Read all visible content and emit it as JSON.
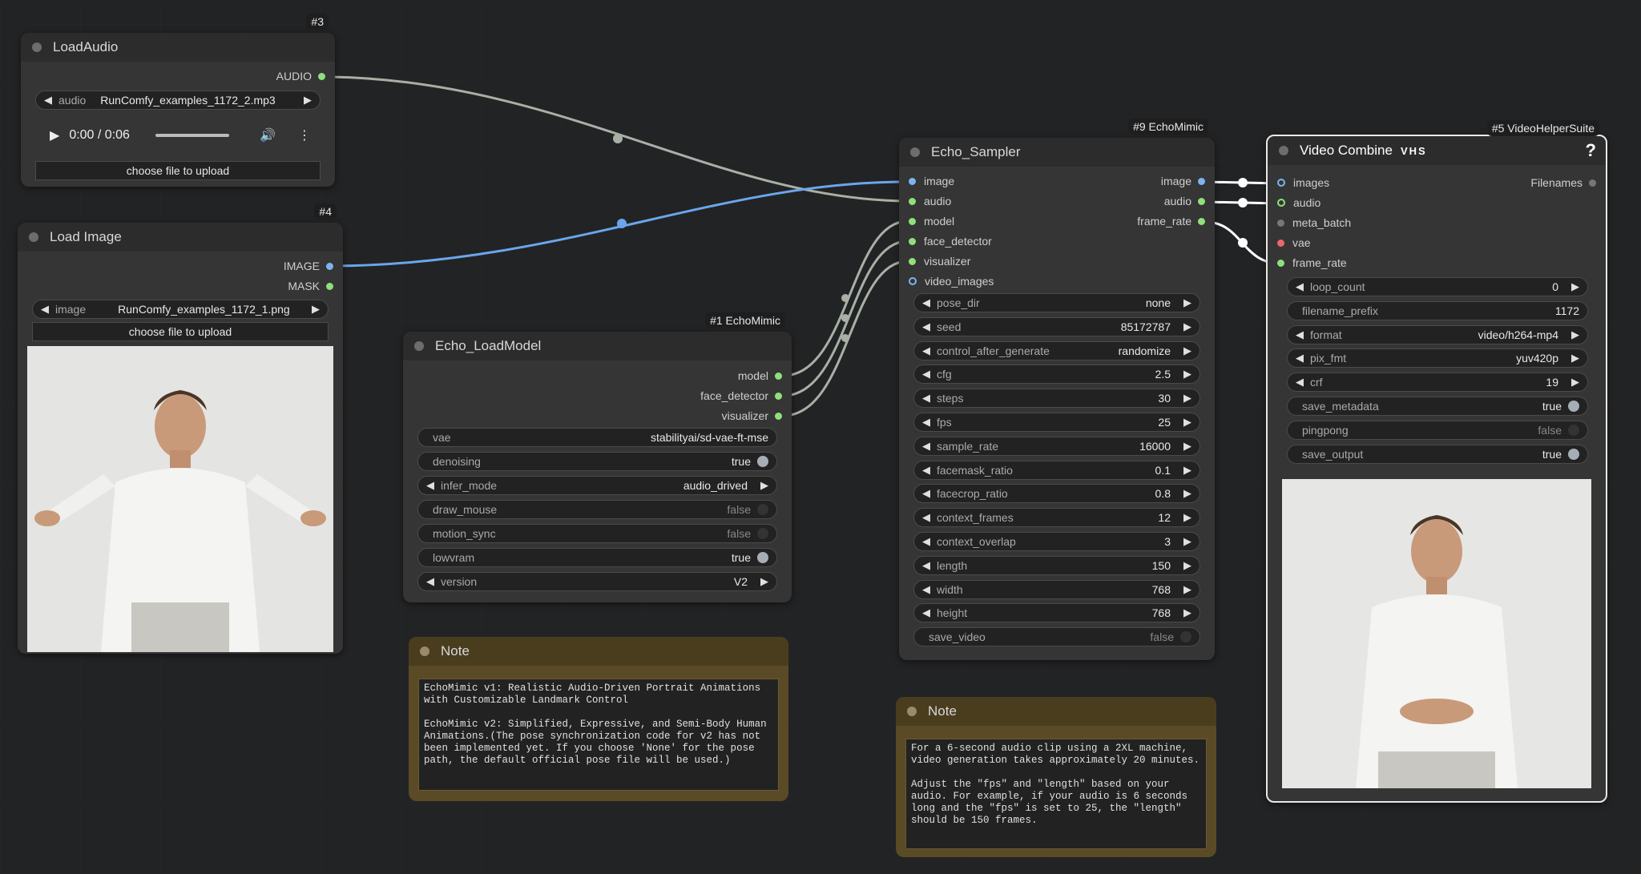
{
  "colors": {
    "canvas": "#222324",
    "node": "#353535",
    "link_audio": "#a8b0a6",
    "link_image": "#6aa6ec",
    "note": "#5a4a25"
  },
  "load_audio": {
    "badge": "#3",
    "title": "LoadAudio",
    "out_audio": "AUDIO",
    "widget_label": "audio",
    "widget_value": "RunComfy_examples_1172_2.mp3",
    "player_time": "0:00 / 0:06",
    "upload_label": "choose file to upload"
  },
  "load_image": {
    "badge": "#4",
    "title": "Load Image",
    "out_image": "IMAGE",
    "out_mask": "MASK",
    "widget_label": "image",
    "widget_value": "RunComfy_examples_1172_1.png",
    "upload_label": "choose file to upload"
  },
  "load_model": {
    "badge": "#1 EchoMimic",
    "title": "Echo_LoadModel",
    "outputs": [
      "model",
      "face_detector",
      "visualizer"
    ],
    "widgets": [
      {
        "label": "vae",
        "value": "stabilityai/sd-vae-ft-mse",
        "kind": "text"
      },
      {
        "label": "denoising",
        "value": "true",
        "kind": "toggle-on"
      },
      {
        "label": "infer_mode",
        "value": "audio_drived",
        "kind": "combo"
      },
      {
        "label": "draw_mouse",
        "value": "false",
        "kind": "toggle-off"
      },
      {
        "label": "motion_sync",
        "value": "false",
        "kind": "toggle-off"
      },
      {
        "label": "lowvram",
        "value": "true",
        "kind": "toggle-on"
      },
      {
        "label": "version",
        "value": "V2",
        "kind": "combo"
      }
    ]
  },
  "sampler": {
    "badge": "#9 EchoMimic",
    "title": "Echo_Sampler",
    "inputs": [
      "image",
      "audio",
      "model",
      "face_detector",
      "visualizer",
      "video_images"
    ],
    "outputs": [
      "image",
      "audio",
      "frame_rate"
    ],
    "widgets": [
      {
        "label": "pose_dir",
        "value": "none",
        "kind": "combo"
      },
      {
        "label": "seed",
        "value": "85172787",
        "kind": "combo"
      },
      {
        "label": "control_after_generate",
        "value": "randomize",
        "kind": "combo"
      },
      {
        "label": "cfg",
        "value": "2.5",
        "kind": "combo"
      },
      {
        "label": "steps",
        "value": "30",
        "kind": "combo"
      },
      {
        "label": "fps",
        "value": "25",
        "kind": "combo"
      },
      {
        "label": "sample_rate",
        "value": "16000",
        "kind": "combo"
      },
      {
        "label": "facemask_ratio",
        "value": "0.1",
        "kind": "combo"
      },
      {
        "label": "facecrop_ratio",
        "value": "0.8",
        "kind": "combo"
      },
      {
        "label": "context_frames",
        "value": "12",
        "kind": "combo"
      },
      {
        "label": "context_overlap",
        "value": "3",
        "kind": "combo"
      },
      {
        "label": "length",
        "value": "150",
        "kind": "combo"
      },
      {
        "label": "width",
        "value": "768",
        "kind": "combo"
      },
      {
        "label": "height",
        "value": "768",
        "kind": "combo"
      },
      {
        "label": "save_video",
        "value": "false",
        "kind": "toggle-off"
      }
    ]
  },
  "video_combine": {
    "badge": "#5 VideoHelperSuite",
    "title": "Video Combine",
    "title_tag": "VHS",
    "help": "?",
    "inputs": [
      "images",
      "audio",
      "meta_batch",
      "vae",
      "frame_rate"
    ],
    "output": "Filenames",
    "widgets": [
      {
        "label": "loop_count",
        "value": "0",
        "kind": "combo"
      },
      {
        "label": "filename_prefix",
        "value": "1172",
        "kind": "text"
      },
      {
        "label": "format",
        "value": "video/h264-mp4",
        "kind": "combo"
      },
      {
        "label": "pix_fmt",
        "value": "yuv420p",
        "kind": "combo"
      },
      {
        "label": "crf",
        "value": "19",
        "kind": "combo"
      },
      {
        "label": "save_metadata",
        "value": "true",
        "kind": "toggle-on"
      },
      {
        "label": "pingpong",
        "value": "false",
        "kind": "toggle-off"
      },
      {
        "label": "save_output",
        "value": "true",
        "kind": "toggle-on"
      }
    ]
  },
  "note1": {
    "title": "Note",
    "text": "EchoMimic v1: Realistic Audio-Driven Portrait Animations\nwith Customizable Landmark Control\n\nEchoMimic v2: Simplified, Expressive, and Semi-Body Human\nAnimations.(The pose synchronization code for v2 has not\nbeen implemented yet. If you choose 'None' for the pose\npath, the default official pose file will be used.)"
  },
  "note2": {
    "title": "Note",
    "text": "For a 6-second audio clip using a 2XL machine,\nvideo generation takes approximately 20 minutes.\n\nAdjust the \"fps\" and \"length\" based on your\naudio. For example, if your audio is 6 seconds\nlong and the \"fps\" is set to 25, the \"length\"\nshould be 150 frames."
  }
}
